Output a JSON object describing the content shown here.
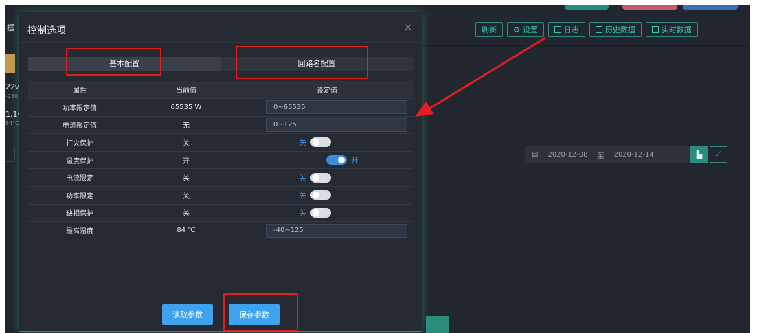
{
  "toolbar": {
    "refresh": "刷新",
    "settings": "设置",
    "log": "日志",
    "history": "历史数据",
    "realtime": "实时数据"
  },
  "datebar": {
    "start": "2020-12-08",
    "separator": "至",
    "end": "2020-12-14"
  },
  "peek": {
    "tail": "据",
    "v1": "22",
    "u1": "V",
    "s1": "-280",
    "v2": "1.1",
    "u2": "V",
    "s2": "84°C"
  },
  "modal": {
    "title": "控制选项",
    "close": "×",
    "tabs": [
      "基本配置",
      "回路名配置"
    ],
    "columns": [
      "属性",
      "当前值",
      "设定值"
    ],
    "rows": [
      {
        "name": "功率限定值",
        "current": "65535 W",
        "placeholder": "0~65535"
      },
      {
        "name": "电流限定值",
        "current": "无",
        "placeholder": "0~125"
      },
      {
        "name": "打火保护",
        "current": "关",
        "switch_label": "关",
        "on": false
      },
      {
        "name": "温度保护",
        "current": "开",
        "switch_label": "开",
        "on": true
      },
      {
        "name": "电流限定",
        "current": "关",
        "switch_label": "关",
        "on": false
      },
      {
        "name": "功率限定",
        "current": "关",
        "switch_label": "关",
        "on": false
      },
      {
        "name": "缺相保护",
        "current": "关",
        "switch_label": "关",
        "on": false
      },
      {
        "name": "最高温度",
        "current": "84 ℃",
        "placeholder": "-40~125"
      }
    ],
    "read_button": "读取参数",
    "save_button": "保存参数"
  },
  "colors": {
    "accent_teal": "#36c6b2",
    "button_blue": "#3ea2ee",
    "highlight_red": "#e02020",
    "background": "#22262e"
  }
}
